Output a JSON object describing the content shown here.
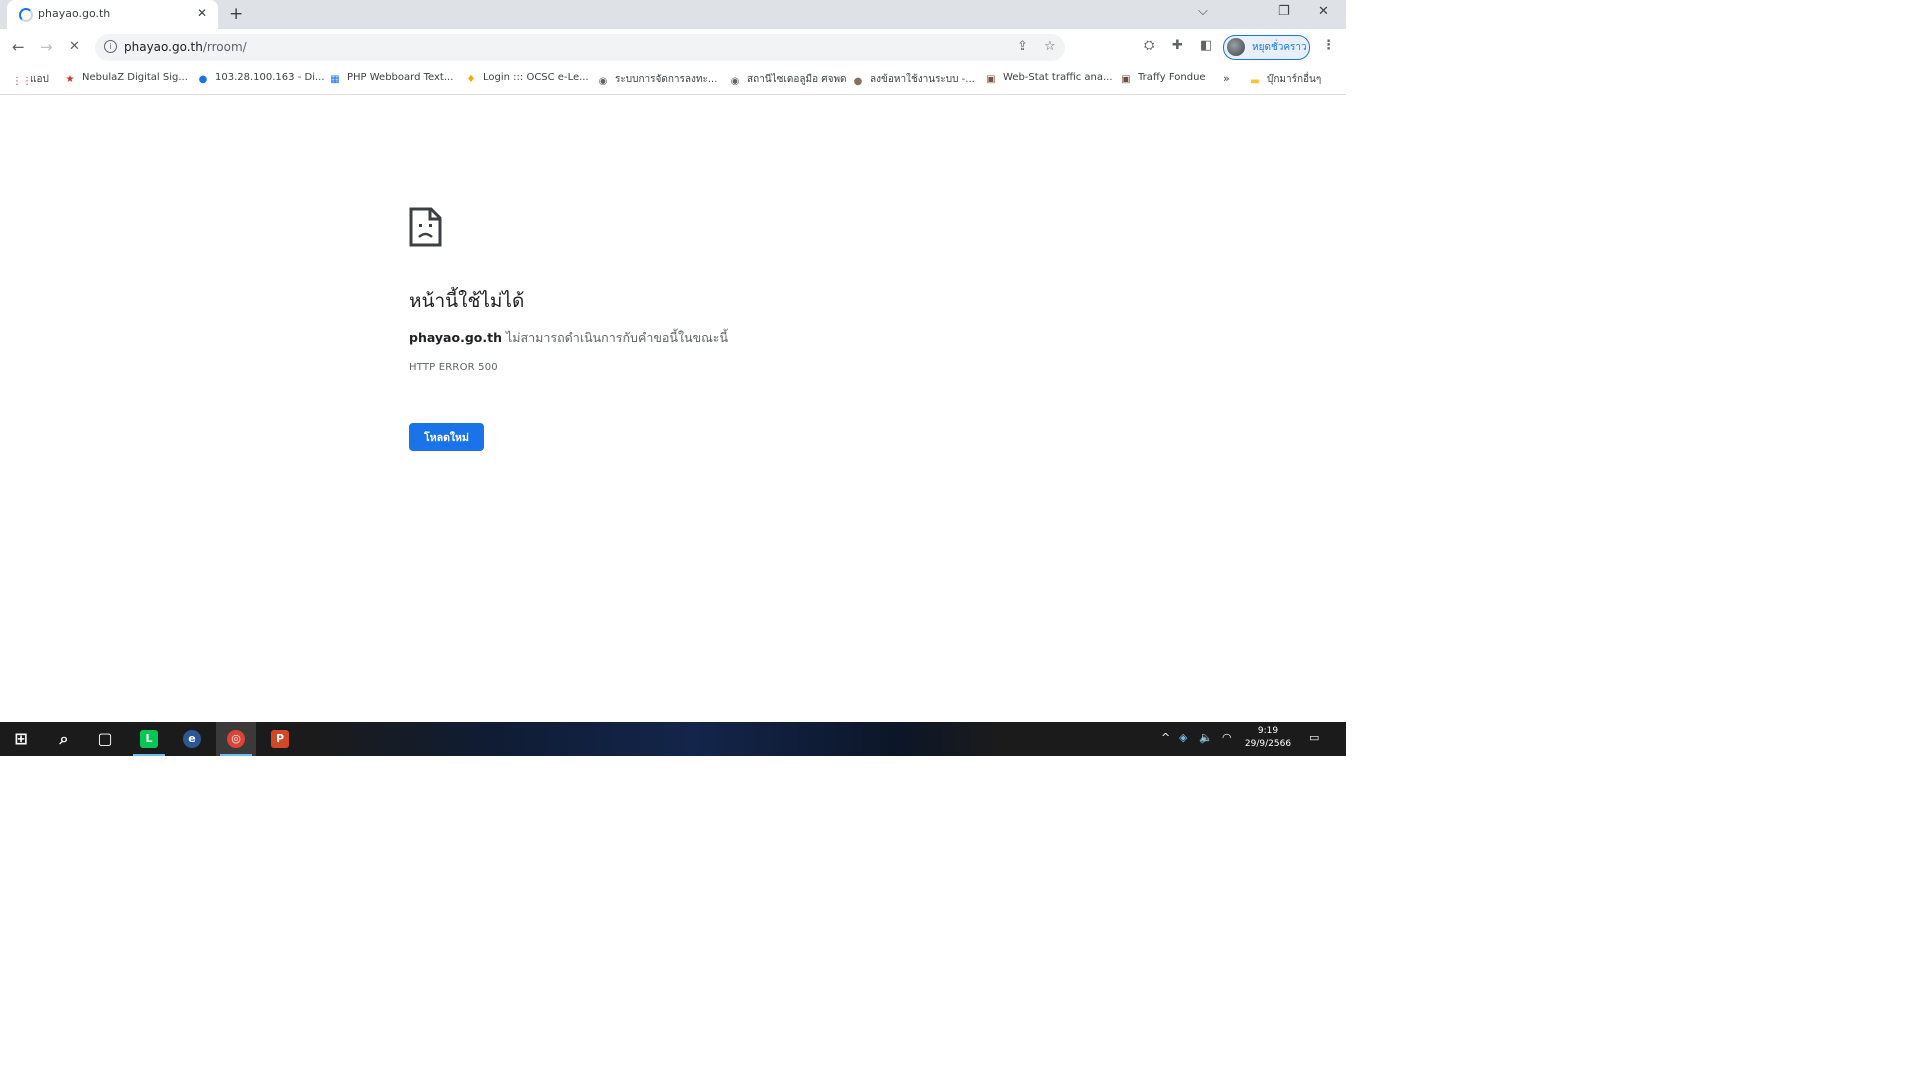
{
  "browser": {
    "tab": {
      "title": "phayao.go.th",
      "close_glyph": "✕"
    },
    "new_tab_glyph": "+",
    "window_controls": {
      "chevron": "⌵",
      "restore": "❐",
      "close": "✕"
    },
    "nav": {
      "back": "←",
      "forward": "→",
      "stop": "✕"
    },
    "address_bar": {
      "host": "phayao.go.th",
      "path": "/rroom/"
    },
    "toolbar_icons": {
      "share": "⇪",
      "star": "☆",
      "extension": "⛭",
      "puzzle": "✚",
      "sidepanel": "◧",
      "menu": "⋮"
    },
    "profile": {
      "label": "หยุดชั่วคราว"
    }
  },
  "bookmarks": [
    {
      "label": "แอป",
      "icon": "apps-grid-icon",
      "glyph": "⋮⋮",
      "color": "#d93025"
    },
    {
      "label": "NebulaZ Digital Sig...",
      "icon": "star-logo-icon",
      "glyph": "★",
      "color": "#d93025"
    },
    {
      "label": "103.28.100.163 - Di...",
      "icon": "blue-dot-icon",
      "glyph": "●",
      "color": "#1a73e8"
    },
    {
      "label": "PHP Webboard Text...",
      "icon": "calendar-icon",
      "glyph": "▦",
      "color": "#1a73e8"
    },
    {
      "label": "Login ::: OCSC e-Le...",
      "icon": "flame-icon",
      "glyph": "♦",
      "color": "#f9ab00"
    },
    {
      "label": "ระบบการจัดการลงทะ...",
      "icon": "globe-icon",
      "glyph": "◉",
      "color": "#5f6368"
    },
    {
      "label": "สถานีไซเดอลูมือ ศจพด",
      "icon": "globe-icon",
      "glyph": "◉",
      "color": "#5f6368"
    },
    {
      "label": "ลงข้อหาใช้งานระบบ -...",
      "icon": "brown-circle-icon",
      "glyph": "●",
      "color": "#8d6e63"
    },
    {
      "label": "Web-Stat traffic ana...",
      "icon": "webstat-icon",
      "glyph": "▣",
      "color": "#795548"
    },
    {
      "label": "Traffy Fondue",
      "icon": "traffy-icon",
      "glyph": "▣",
      "color": "#6d4c41"
    },
    {
      "label": "»",
      "icon": "",
      "glyph": "",
      "color": "#5f6368"
    },
    {
      "label": "บุ๊กมาร์กอื่นๆ",
      "icon": "folder-icon",
      "glyph": "▬",
      "color": "#fbc02d"
    }
  ],
  "error_page": {
    "title": "หน้านี้ใช้ไม่ได้",
    "host": "phayao.go.th",
    "message": "ไม่สามารถดำเนินการกับคำขอนี้ในขณะนี้",
    "code": "HTTP ERROR 500",
    "reload_label": "โหลดใหม่"
  },
  "taskbar": {
    "apps": [
      {
        "name": "start",
        "glyph": "⊞",
        "bg": "transparent"
      },
      {
        "name": "search",
        "glyph": "⌕",
        "bg": "transparent"
      },
      {
        "name": "task-view",
        "glyph": "▢",
        "bg": "transparent"
      },
      {
        "name": "line",
        "glyph": "L",
        "bg": "#06c755"
      },
      {
        "name": "ie",
        "glyph": "e",
        "bg": "#2b5797"
      },
      {
        "name": "chrome",
        "glyph": "◎",
        "bg": "#db4437"
      },
      {
        "name": "powerpoint",
        "glyph": "P",
        "bg": "#d24726"
      }
    ],
    "tray": {
      "chevron": "^",
      "network": "◈",
      "volume": "🔈",
      "wifi": "◠",
      "notifications": "▭"
    },
    "clock": {
      "time": "9:19",
      "date": "29/9/2566"
    }
  }
}
